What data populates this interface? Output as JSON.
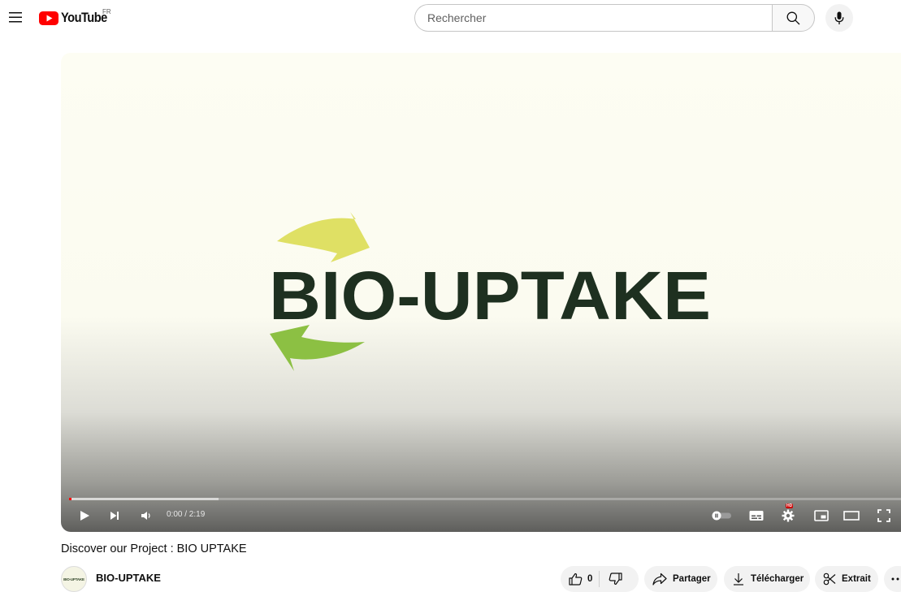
{
  "masthead": {
    "menu_icon": "hamburger-menu-icon",
    "logo_text": "YouTube",
    "country_code": "FR",
    "search_placeholder": "Rechercher",
    "search_value": "",
    "search_icon": "search-icon",
    "mic_icon": "microphone-icon"
  },
  "player": {
    "logo_title": "BIO-UPTAKE",
    "time_display": "0:00 / 2:19",
    "progress_played": 0.003,
    "progress_loaded": 0.18,
    "hd_badge": "HD",
    "controls": [
      "play-icon",
      "next-icon",
      "volume-icon",
      "autoplay-toggle-icon",
      "subtitles-icon",
      "settings-icon",
      "miniplayer-icon",
      "theater-mode-icon",
      "fullscreen-icon"
    ],
    "colors": {
      "logo_text": "#1e3020",
      "arrow_yellow": "#dfe064",
      "arrow_green": "#8cc043",
      "progress_played": "#ff0000"
    }
  },
  "video": {
    "title": "Discover our Project : BIO UPTAKE",
    "channel_name": "BIO-UPTAKE",
    "channel_avatar_text": "BIO-UPTAKE"
  },
  "actions": {
    "like_count": "0",
    "share_label": "Partager",
    "download_label": "Télécharger",
    "clip_label": "Extrait",
    "more_icon": "more-horizontal-icon"
  }
}
